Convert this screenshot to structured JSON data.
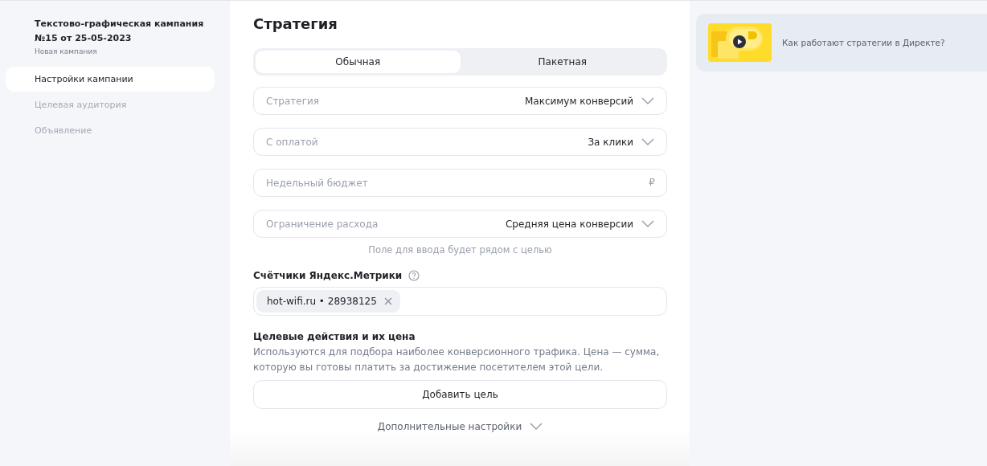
{
  "sidebar": {
    "title": "Текстово-графическая кампания №15 от 25-05-2023",
    "subtitle": "Новая кампания",
    "items": [
      {
        "label": "Настройки кампании",
        "selected": true
      },
      {
        "label": "Целевая аудитория",
        "selected": false
      },
      {
        "label": "Объявление",
        "selected": false
      }
    ]
  },
  "main": {
    "heading": "Стратегия",
    "tabs": [
      {
        "label": "Обычная",
        "selected": true
      },
      {
        "label": "Пакетная",
        "selected": false
      }
    ],
    "fields": [
      {
        "kind": "select",
        "label": "Стратегия",
        "value": "Максимум конверсий"
      },
      {
        "kind": "select",
        "label": "С оплатой",
        "value": "За клики"
      },
      {
        "kind": "input",
        "placeholder": "Недельный бюджет",
        "suffix": "₽"
      },
      {
        "kind": "select",
        "label": "Ограничение расхода",
        "value": "Средняя цена конверсии"
      }
    ],
    "field_hint": "Поле для ввода будет рядом с целью",
    "counters": {
      "label": "Счётчики Яндекс.Метрики",
      "tags": [
        "hot-wifi.ru • 28938125"
      ]
    },
    "goals": {
      "title": "Целевые действия и их цена",
      "description": "Используются для подбора наиболее конверсионного трафика. Цена — сумма, которую вы готовы платить за достижение посетителем этой цели.",
      "button": "Добавить цель"
    },
    "more_settings": "Дополнительные настройки"
  },
  "help_card": {
    "text": "Как работают стратегии в Директе?"
  }
}
